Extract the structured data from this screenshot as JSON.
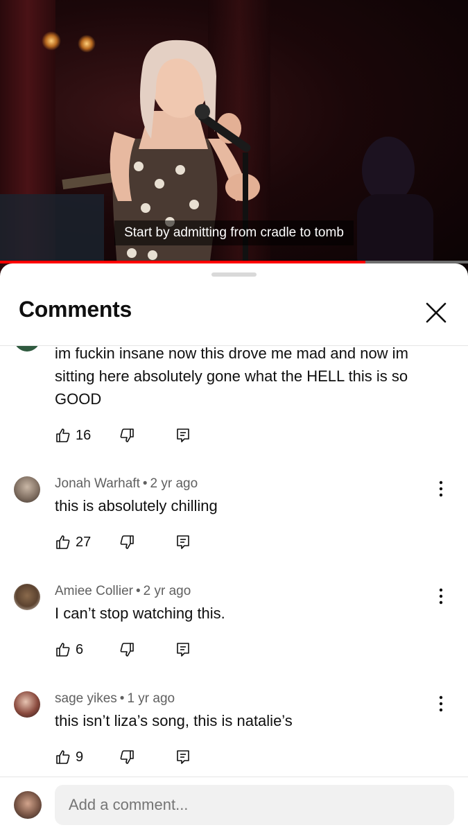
{
  "video": {
    "caption": "Start by admitting from cradle to tomb",
    "progress_fraction": 0.78
  },
  "sheet": {
    "title": "Comments"
  },
  "comments": [
    {
      "author": "",
      "age": "",
      "text": "im fuckin insane now this drove me mad and now im sitting here absolutely gone what the HELL this is so GOOD",
      "likes": "16"
    },
    {
      "author": "Jonah Warhaft",
      "age": "2 yr ago",
      "text": "this is absolutely chilling",
      "likes": "27"
    },
    {
      "author": "Amiee Collier",
      "age": "2 yr ago",
      "text": "I can’t stop watching this.",
      "likes": "6"
    },
    {
      "author": "sage yikes",
      "age": "1 yr ago",
      "text": "this isn’t liza’s song, this is natalie’s",
      "likes": "9"
    }
  ],
  "separator": "•",
  "composer": {
    "placeholder": "Add a comment..."
  },
  "colors": {
    "progress": "#ff0000",
    "text_primary": "#0f0f0f",
    "text_secondary": "#606060"
  }
}
